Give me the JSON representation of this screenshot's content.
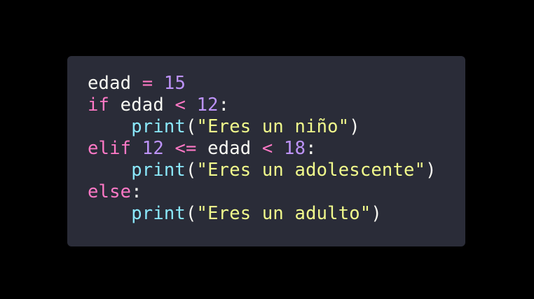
{
  "colors": {
    "background": "#000000",
    "card": "#2a2c38",
    "plain": "#f8f8f2",
    "keyword": "#ff79c6",
    "operator": "#ff79c6",
    "number": "#bd93f9",
    "function": "#8be9fd",
    "string": "#f1fa8c"
  },
  "code": {
    "language": "python",
    "lines": [
      [
        {
          "type": "plain",
          "text": "edad "
        },
        {
          "type": "op",
          "text": "="
        },
        {
          "type": "plain",
          "text": " "
        },
        {
          "type": "num",
          "text": "15"
        }
      ],
      [
        {
          "type": "kw",
          "text": "if"
        },
        {
          "type": "plain",
          "text": " edad "
        },
        {
          "type": "op",
          "text": "<"
        },
        {
          "type": "plain",
          "text": " "
        },
        {
          "type": "num",
          "text": "12"
        },
        {
          "type": "punc",
          "text": ":"
        }
      ],
      [
        {
          "type": "plain",
          "text": "    "
        },
        {
          "type": "func",
          "text": "print"
        },
        {
          "type": "punc",
          "text": "("
        },
        {
          "type": "str",
          "text": "\"Eres un niño\""
        },
        {
          "type": "punc",
          "text": ")"
        }
      ],
      [
        {
          "type": "kw",
          "text": "elif"
        },
        {
          "type": "plain",
          "text": " "
        },
        {
          "type": "num",
          "text": "12"
        },
        {
          "type": "plain",
          "text": " "
        },
        {
          "type": "op",
          "text": "<="
        },
        {
          "type": "plain",
          "text": " edad "
        },
        {
          "type": "op",
          "text": "<"
        },
        {
          "type": "plain",
          "text": " "
        },
        {
          "type": "num",
          "text": "18"
        },
        {
          "type": "punc",
          "text": ":"
        }
      ],
      [
        {
          "type": "plain",
          "text": "    "
        },
        {
          "type": "func",
          "text": "print"
        },
        {
          "type": "punc",
          "text": "("
        },
        {
          "type": "str",
          "text": "\"Eres un adolescente\""
        },
        {
          "type": "punc",
          "text": ")"
        }
      ],
      [
        {
          "type": "kw",
          "text": "else"
        },
        {
          "type": "punc",
          "text": ":"
        }
      ],
      [
        {
          "type": "plain",
          "text": "    "
        },
        {
          "type": "func",
          "text": "print"
        },
        {
          "type": "punc",
          "text": "("
        },
        {
          "type": "str",
          "text": "\"Eres un adulto\""
        },
        {
          "type": "punc",
          "text": ")"
        }
      ]
    ]
  }
}
